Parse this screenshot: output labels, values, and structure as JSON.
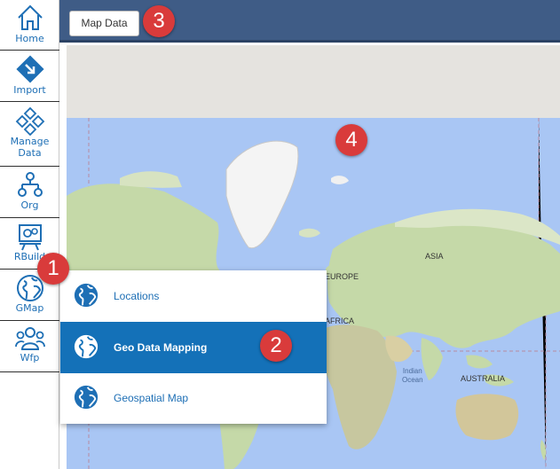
{
  "sidebar": {
    "items": [
      {
        "label": "Home",
        "icon": "home-icon"
      },
      {
        "label": "Import",
        "icon": "import-icon"
      },
      {
        "label": "Manage\nData",
        "icon": "manage-data-icon"
      },
      {
        "label": "Org",
        "icon": "org-chart-icon"
      },
      {
        "label": "RBuild",
        "icon": "rbuild-icon"
      },
      {
        "label": "GMap",
        "icon": "globe-icon"
      },
      {
        "label": "Wfp",
        "icon": "people-icon"
      }
    ]
  },
  "topbar": {
    "button_label": "Map Data"
  },
  "gmap_menu": {
    "items": [
      {
        "label": "Locations",
        "icon": "globe-icon",
        "active": false
      },
      {
        "label": "Geo Data Mapping",
        "icon": "globe-icon",
        "active": true
      },
      {
        "label": "Geospatial Map",
        "icon": "globe-icon",
        "active": false
      }
    ]
  },
  "map": {
    "labels": [
      "EUROPE",
      "AFRICA",
      "ASIA",
      "Indian\nOcean",
      "AUSTRALIA"
    ]
  },
  "callouts": [
    "1",
    "2",
    "3",
    "4"
  ],
  "colors": {
    "accent": "#1471b8",
    "topbar": "#3f5c86",
    "callout": "#d93b3b",
    "water": "#a9c6f4",
    "land": "#c5d9a8"
  }
}
